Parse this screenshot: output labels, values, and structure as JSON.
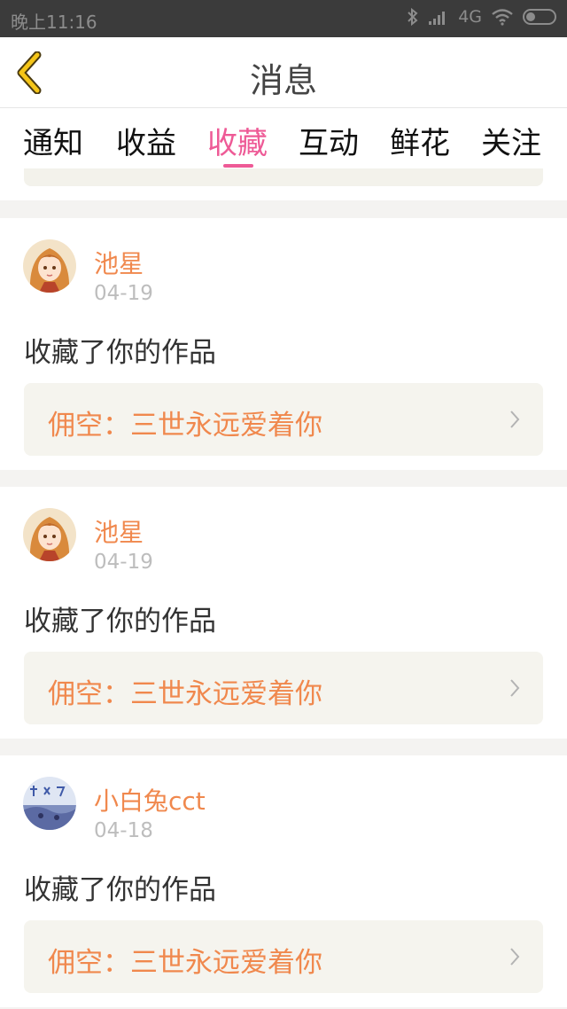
{
  "status_bar": {
    "time": "晚上11:16",
    "network": "4G",
    "icons": [
      "bluetooth-icon",
      "signal-icon",
      "wifi-icon",
      "battery-icon"
    ]
  },
  "header": {
    "title": "消息",
    "back_icon": "chevron-left-icon"
  },
  "tabs": [
    {
      "label": "通知",
      "active": false
    },
    {
      "label": "收益",
      "active": false
    },
    {
      "label": "收藏",
      "active": true
    },
    {
      "label": "互动",
      "active": false
    },
    {
      "label": "鲜花",
      "active": false
    },
    {
      "label": "关注",
      "active": false
    }
  ],
  "messages": [
    {
      "user": "池星",
      "date": "04-19",
      "action": "收藏了你的作品",
      "work_title": "佣空：三世永远爱着你",
      "avatar": "anime-girl-avatar"
    },
    {
      "user": "池星",
      "date": "04-19",
      "action": "收藏了你的作品",
      "work_title": "佣空：三世永远爱着你",
      "avatar": "anime-girl-avatar"
    },
    {
      "user": "小白兔cct",
      "date": "04-18",
      "action": "收藏了你的作品",
      "work_title": "佣空：三世永远爱着你",
      "avatar": "blue-scene-avatar"
    }
  ],
  "colors": {
    "accent_pink": "#ee5a96",
    "accent_orange": "#f0884d",
    "status_bar": "#3b3b3b",
    "card_bg": "#f5f4ee"
  }
}
